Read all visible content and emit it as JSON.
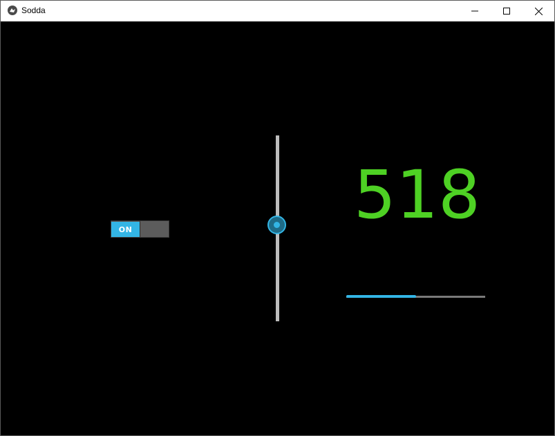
{
  "window": {
    "title": "Sodda",
    "controls": {
      "minimize": "minimize-icon",
      "maximize": "maximize-icon",
      "close": "close-icon"
    }
  },
  "switch": {
    "label": "ON",
    "active": true,
    "accent_color": "#33b5e5"
  },
  "slider": {
    "orientation": "vertical",
    "value_fraction": 0.52
  },
  "display": {
    "value": "518",
    "color": "#4ed124"
  },
  "progress": {
    "value_fraction": 0.5,
    "color": "#33b5e5"
  }
}
